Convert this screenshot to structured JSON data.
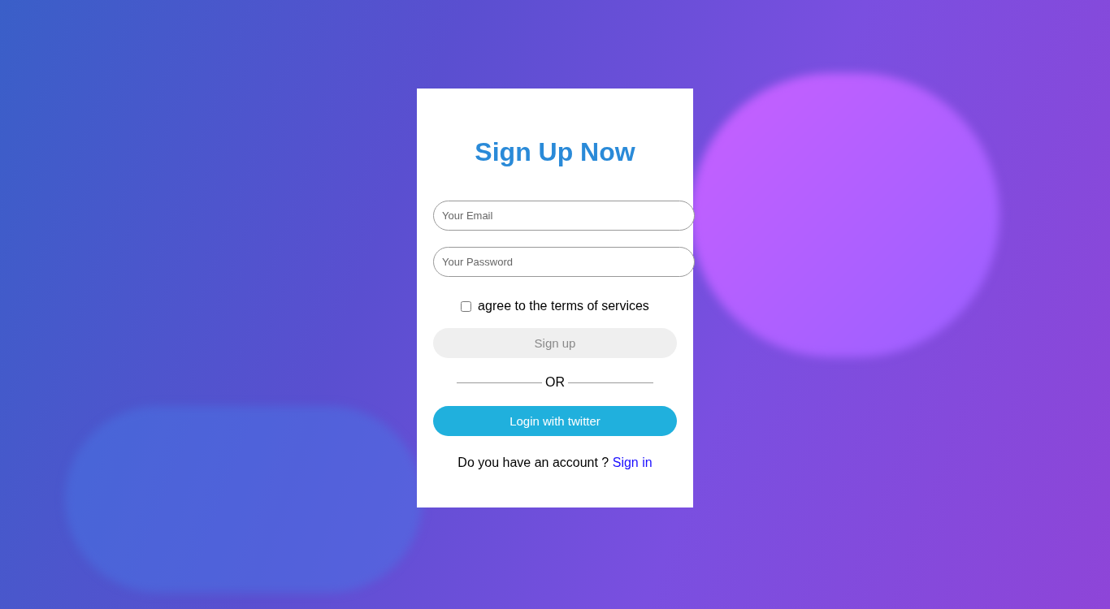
{
  "form": {
    "title": "Sign Up Now",
    "fields": [
      {
        "placeholder": "Your Email"
      },
      {
        "placeholder": "Your Password"
      }
    ],
    "terms": {
      "label": "agree to the terms of services",
      "checked": false
    },
    "signup_button": {
      "label": "Sign up",
      "disabled": true
    },
    "divider": "OR",
    "twitter_button": {
      "label": "Login with twitter"
    },
    "footer": {
      "text": "Do you have an account ?",
      "link": "Sign in"
    }
  }
}
